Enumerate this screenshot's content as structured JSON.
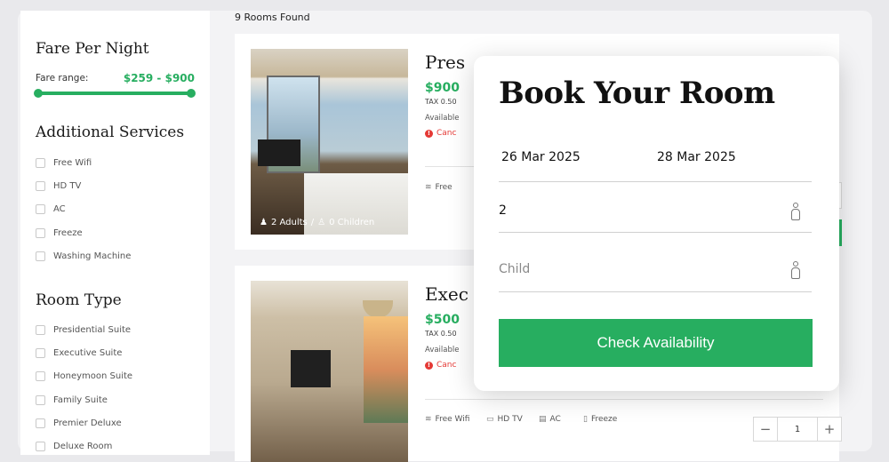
{
  "sidebar": {
    "fare_title": "Fare Per Night",
    "fare_label": "Fare range:",
    "fare_value": "$259 - $900",
    "services_title": "Additional Services",
    "services": [
      "Free Wifi",
      "HD TV",
      "AC",
      "Freeze",
      "Washing Machine"
    ],
    "room_type_title": "Room Type",
    "room_types": [
      "Presidential Suite",
      "Executive Suite",
      "Honeymoon Suite",
      "Family Suite",
      "Premier Deluxe",
      "Deluxe Room"
    ]
  },
  "results": {
    "count_text": "9 Rooms Found"
  },
  "rooms": [
    {
      "title": "Pres",
      "price": "$900",
      "tax": "TAX 0.50",
      "available": "Available",
      "cancel": "Canc",
      "guests": "2 Adults",
      "children": "0 Children",
      "feature": "Free"
    },
    {
      "title": "Exec",
      "price": "$500",
      "tax": "TAX 0.50",
      "available": "Available",
      "cancel": "Canc",
      "features": [
        "Free Wifi",
        "HD TV",
        "AC",
        "Freeze"
      ],
      "quantity": "1"
    }
  ],
  "booking": {
    "title": "Book Your Room",
    "check_in": "26 Mar 2025",
    "check_out": "28 Mar 2025",
    "adults": "2",
    "child_placeholder": "Child",
    "button": "Check Availability"
  },
  "colors": {
    "accent": "#27ae60",
    "danger": "#e53935"
  }
}
